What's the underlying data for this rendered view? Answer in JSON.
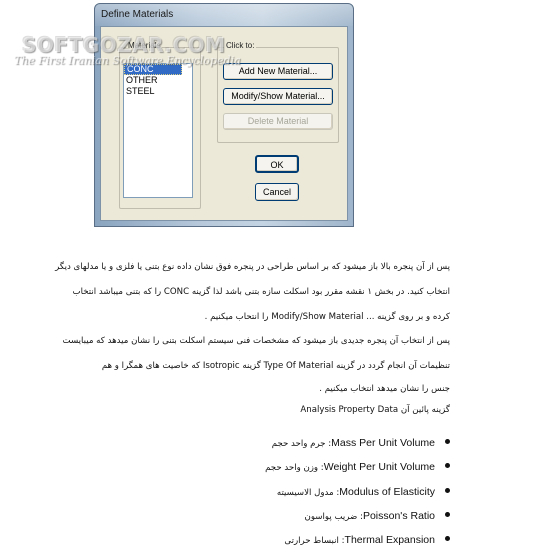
{
  "dialog": {
    "title": "Define Materials",
    "materials_group_label": "Materials",
    "click_group_label": "Click to:",
    "materials": [
      "CONC",
      "OTHER",
      "STEEL"
    ],
    "selected_material": "CONC",
    "buttons": {
      "add_new": "Add New Material...",
      "modify_show": "Modify/Show Material...",
      "delete": "Delete Material",
      "ok": "OK",
      "cancel": "Cancel"
    }
  },
  "watermark": {
    "brand": "SOFTGOZAR.COM",
    "tagline": "The First Iranian Software Encyclopedia"
  },
  "article": {
    "p1": [
      "پس از آن پنجره بالا باز میشود که بر اساس طراحی در پنجره فوق نشان داده نوع بتنی یا فلزی و یا مدلهای دیگر",
      "انتخاب کنید. در بخش ۱ نقشه مقرر بود اسکلت سازه بتنی باشد لذا گزینه  CONC  را که بتنی میباشد انتخاب",
      "کرده و بر روی گزینه  ... Modify/Show Material را انتحاب میکنیم ."
    ],
    "p2": [
      "پس از انتخاب آن پنجره جدیدی باز میشود که مشخصات فنی سیستم اسکلت بتنی را نشان میدهد که میبایست",
      "تنظیمات آن انجام گردد در گزینه  Type Of Material  گزینه  Isotropic  که خاصیت های همگرا و هم",
      "جنس را نشان میدهد انتخاب میکنیم ."
    ],
    "p3": "گزینه پائین آن  Analysis Property Data",
    "bullets": [
      {
        "en": "Mass Per Unit Volume",
        "fa": ": جرم واحد حجم"
      },
      {
        "en": "Weight  Per Unit Volume",
        "fa": ": وزن واحد حجم"
      },
      {
        "en": "Modulus of Elasticity",
        "fa": ": مدول الاسیسیته"
      },
      {
        "en": "Poisson's Ratio",
        "fa": ": ضریب پواسون"
      },
      {
        "en": "Thermal Expansion",
        "fa": ": انبساط حرارتی"
      }
    ]
  }
}
